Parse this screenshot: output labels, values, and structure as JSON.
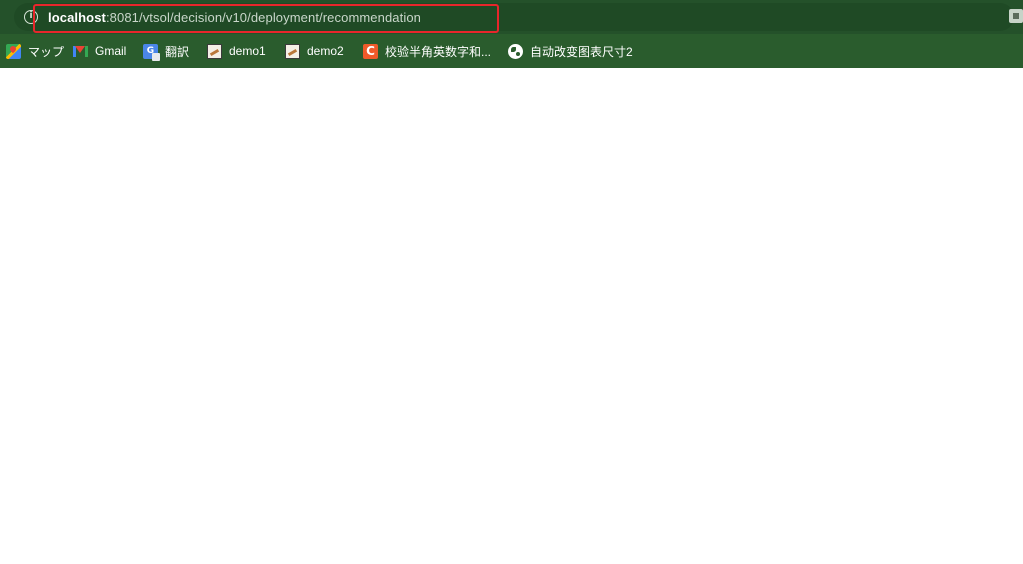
{
  "address_bar": {
    "url_host": "localhost",
    "url_rest": ":8081/vtsol/decision/v10/deployment/recommendation",
    "site_info_icon": "info-circle-icon",
    "translate_icon": "translate-icon"
  },
  "highlight": {
    "color": "#e8262b"
  },
  "bookmarks": [
    {
      "label": "マップ",
      "icon": "maps-icon"
    },
    {
      "label": "Gmail",
      "icon": "gmail-icon"
    },
    {
      "label": "翻訳",
      "icon": "google-translate-icon"
    },
    {
      "label": "demo1",
      "icon": "demo-page-icon"
    },
    {
      "label": "demo2",
      "icon": "demo-page-icon"
    },
    {
      "label": "校验半角英数字和...",
      "icon": "c-logo-icon"
    },
    {
      "label": "自动改变图表尺寸2",
      "icon": "globe-icon"
    }
  ],
  "theme": {
    "toolbar_color": "#2a5c2d",
    "page_background": "#ffffff"
  }
}
